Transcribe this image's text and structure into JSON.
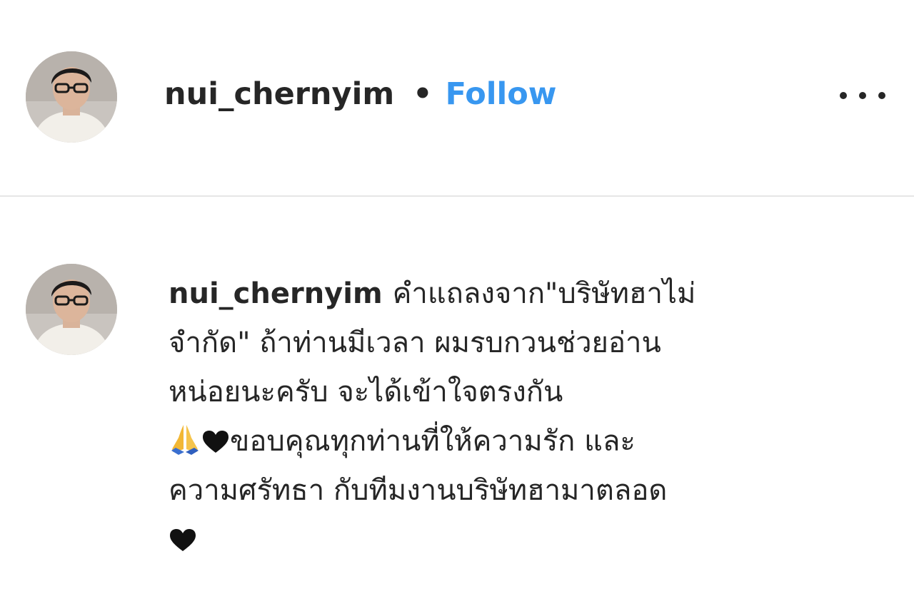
{
  "header": {
    "username": "nui_chernyim",
    "separator": "•",
    "follow_label": "Follow",
    "more_icon": "more-horizontal-icon",
    "avatar_icon": "profile-avatar"
  },
  "comment": {
    "username": "nui_chernyim",
    "line1": "คำแถลงจาก\"บริษัทฮาไม่",
    "line2": "จำกัด\" ถ้าท่านมีเวลา ผมรบกวนช่วยอ่าน",
    "line3": "หน่อยนะครับ จะได้เข้าใจตรงกัน",
    "line4_text": "ขอบคุณทุกท่านที่ให้ความรัก และ",
    "line5": "ความศรัทธา กับทีมงานบริษัทฮามาตลอด",
    "emojis": [
      "folded-hands",
      "black-heart"
    ]
  },
  "colors": {
    "text": "#262626",
    "follow_blue": "#3897f0",
    "divider": "#e6e6e6",
    "background": "#ffffff"
  }
}
